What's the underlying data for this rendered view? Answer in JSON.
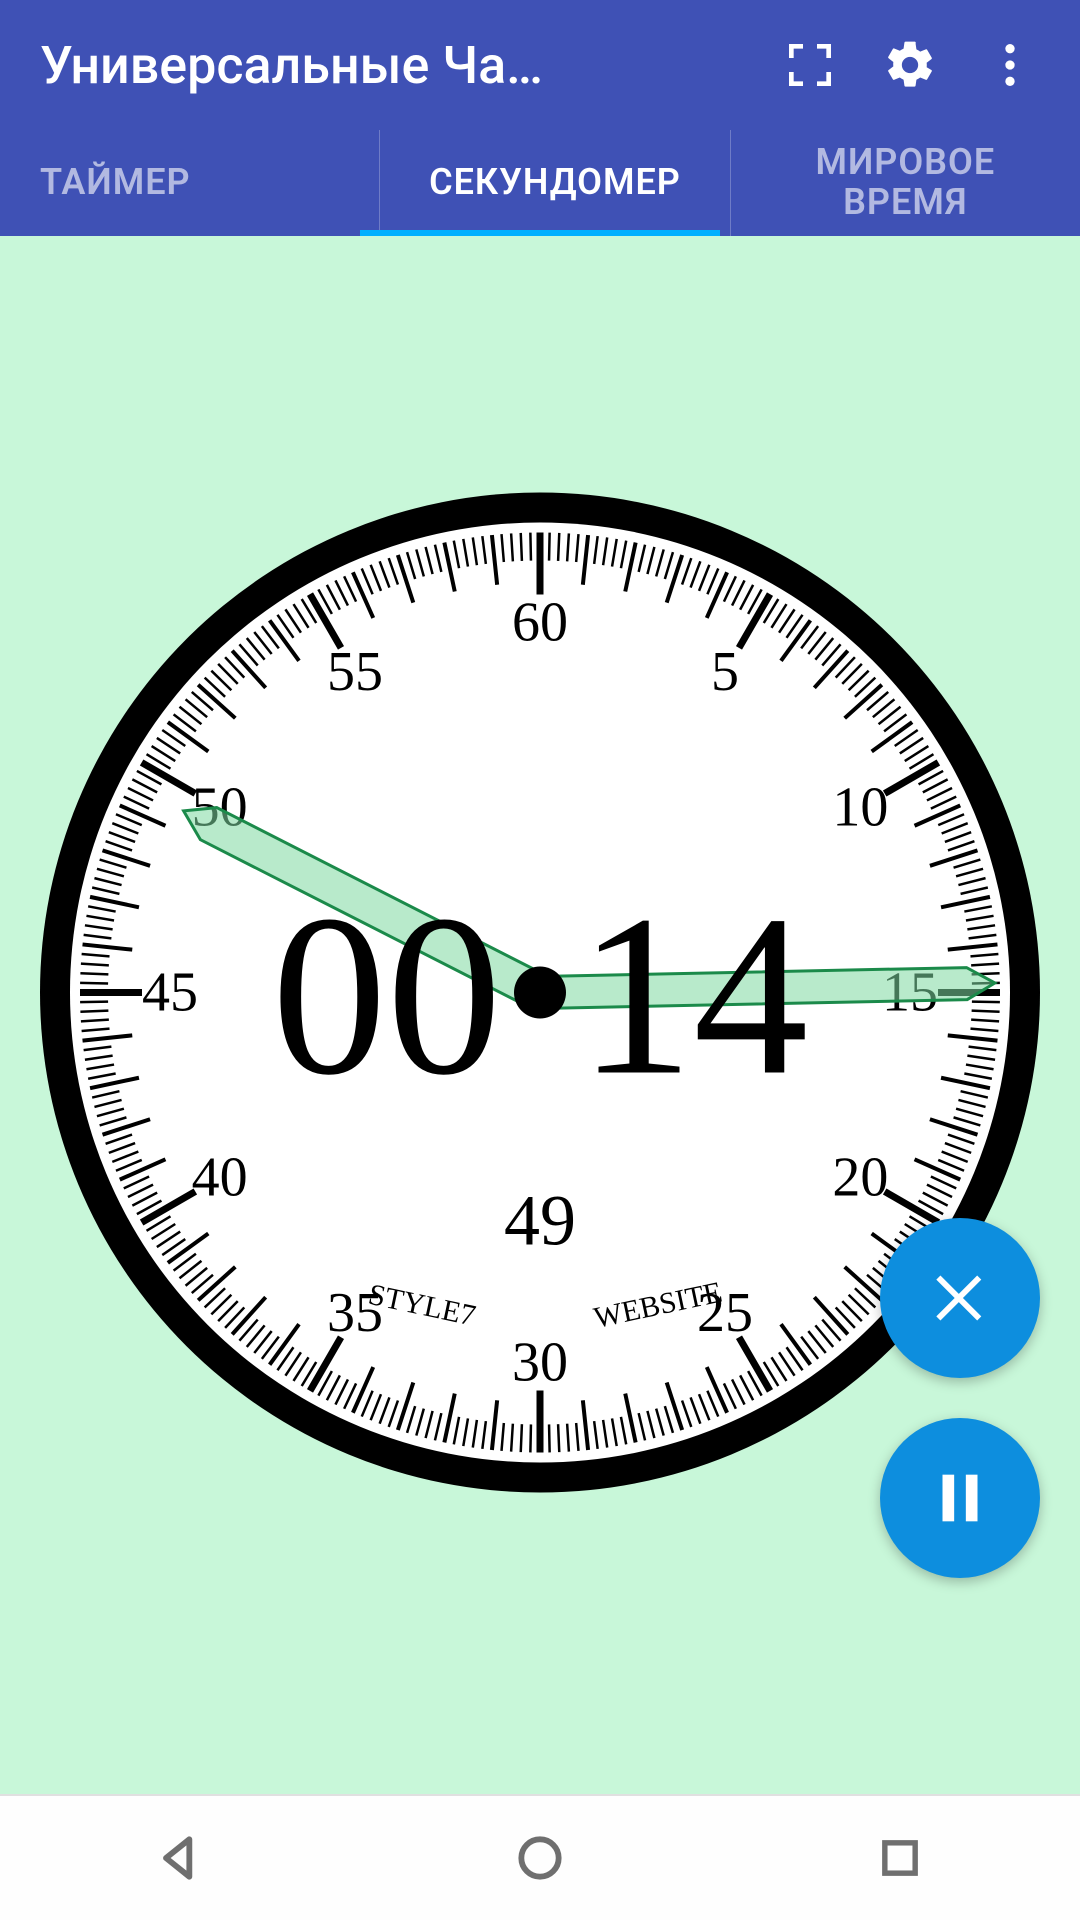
{
  "header": {
    "title": "Универсальные Ча…"
  },
  "tabs": {
    "items": [
      "ТАЙМЕР",
      "СЕКУНДОМЕР",
      "МИРОВОЕ ВРЕМЯ"
    ],
    "active_index": 1
  },
  "clock": {
    "digital": "00·14",
    "subseconds": "49",
    "brand_left": "STYLE7",
    "brand_right": "WEBSITE",
    "numbers": [
      "60",
      "5",
      "10",
      "15",
      "20",
      "25",
      "30",
      "35",
      "40",
      "45",
      "50",
      "55"
    ],
    "second_pos": 14.8,
    "minute_pos": 49.5
  },
  "colors": {
    "header": "#3f51b5",
    "accent": "#00b0ff",
    "fab": "#0d8ede",
    "bg": "#c8f7d9",
    "hand": "#7dd9a0"
  }
}
